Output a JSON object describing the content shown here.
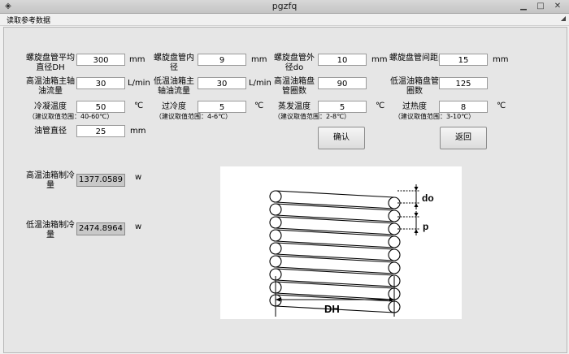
{
  "window": {
    "title": "pgzfq"
  },
  "menu": {
    "item": "读取参考数据"
  },
  "fields": [
    {
      "label": "螺旋盘管平均直径DH",
      "value": "300",
      "unit": "mm"
    },
    {
      "label": "螺旋盘管内径",
      "value": "9",
      "unit": "mm"
    },
    {
      "label": "螺旋盘管外径do",
      "value": "10",
      "unit": "mm"
    },
    {
      "label": "螺旋盘管间距p",
      "value": "15",
      "unit": "mm"
    },
    {
      "label": "高温油箱主轴油流量",
      "value": "30",
      "unit": "L/min"
    },
    {
      "label": "低温油箱主轴油流量",
      "value": "30",
      "unit": "L/min"
    },
    {
      "label": "高温油箱盘管圈数",
      "value": "90",
      "unit": ""
    },
    {
      "label": "低温油箱盘管圈数",
      "value": "125",
      "unit": ""
    },
    {
      "label": "冷凝温度",
      "value": "50",
      "unit": "℃",
      "hint": "（建议取值范围：40-60℃）"
    },
    {
      "label": "过冷度",
      "value": "5",
      "unit": "℃",
      "hint": "（建议取值范围：4-6℃）"
    },
    {
      "label": "蒸发温度",
      "value": "5",
      "unit": "℃",
      "hint": "（建议取值范围：2-8℃）"
    },
    {
      "label": "过热度",
      "value": "8",
      "unit": "℃",
      "hint": "（建议取值范围：3-10℃）"
    },
    {
      "label": "油管直径",
      "value": "25",
      "unit": "mm"
    }
  ],
  "buttons": {
    "confirm": "确认",
    "back": "返回"
  },
  "results": [
    {
      "label": "高温油箱制冷量",
      "value": "1377.0589",
      "unit": "w"
    },
    {
      "label": "低温油箱制冷量",
      "value": "2474.8964",
      "unit": "w"
    }
  ],
  "diagram": {
    "label_do": "do",
    "label_p": "p",
    "label_dh": "DH"
  }
}
